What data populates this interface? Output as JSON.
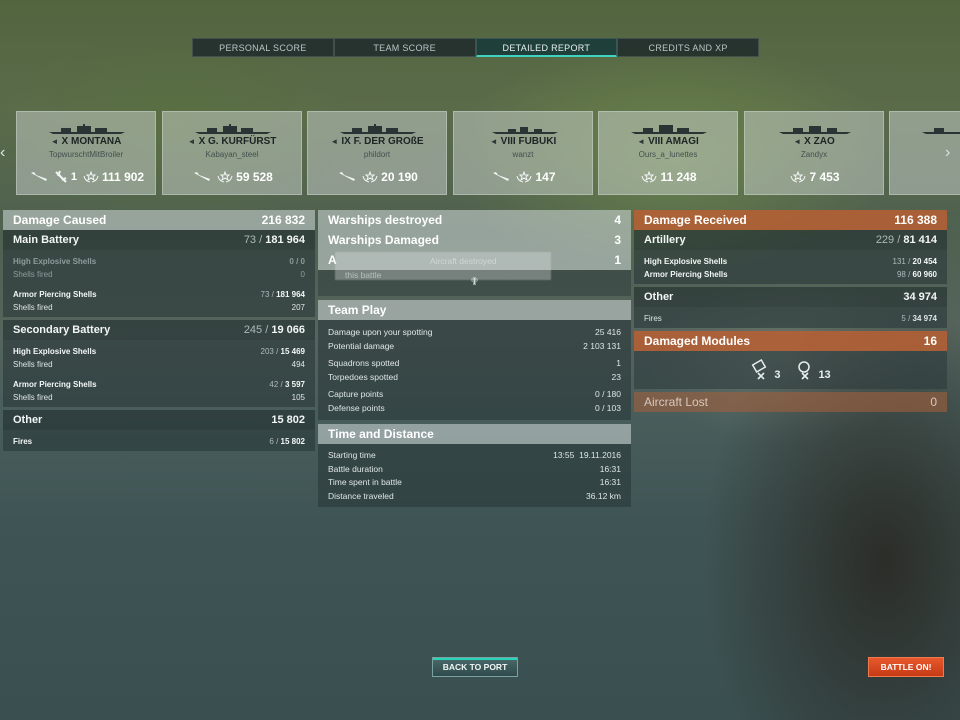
{
  "tabs": [
    {
      "label": "PERSONAL SCORE"
    },
    {
      "label": "TEAM SCORE"
    },
    {
      "label": "DETAILED REPORT"
    },
    {
      "label": "CREDITS AND XP"
    }
  ],
  "active_tab": "DETAILED REPORT",
  "ships": [
    {
      "tier_name": "X MONTANA",
      "player": "TopwurschtMitBroiler",
      "s1": "",
      "s2": "1",
      "s3": "111 902"
    },
    {
      "tier_name": "X G. KURFÜRST",
      "player": "Kabayan_steel",
      "s1": "",
      "s2": "",
      "s3": "59 528"
    },
    {
      "tier_name": "IX F. DER GROßE",
      "player": "phildort",
      "s1": "",
      "s2": "",
      "s3": "20 190"
    },
    {
      "tier_name": "VIII FUBUKI",
      "player": "wanzt",
      "s1": "",
      "s2": "",
      "s3": "147"
    },
    {
      "tier_name": "VIII AMAGI",
      "player": "Ours_a_lunettes",
      "s1": "",
      "s2": "",
      "s3": "11 248"
    },
    {
      "tier_name": "X ZAO",
      "player": "Zandyx",
      "s1": "",
      "s2": "",
      "s3": "7 453"
    }
  ],
  "damage_caused": {
    "title": "Damage Caused",
    "total": "216 832",
    "main_battery": {
      "label": "Main Battery",
      "hits": "73",
      "total": "181 964",
      "he_label": "High Explosive Shells",
      "he_hits": "0",
      "he_total": "0",
      "he_fired_label": "Shells fired",
      "he_fired": "0",
      "ap_label": "Armor Piercing Shells",
      "ap_hits": "73",
      "ap_total": "181 964",
      "ap_fired_label": "Shells fired",
      "ap_fired": "207"
    },
    "secondary_battery": {
      "label": "Secondary Battery",
      "hits": "245",
      "total": "19 066",
      "he_label": "High Explosive Shells",
      "he_hits": "203",
      "he_total": "15 469",
      "he_fired_label": "Shells fired",
      "he_fired": "494",
      "ap_label": "Armor Piercing Shells",
      "ap_hits": "42",
      "ap_total": "3 597",
      "ap_fired_label": "Shells fired",
      "ap_fired": "105"
    },
    "other": {
      "label": "Other",
      "total": "15 802",
      "fires_label": "Fires",
      "fires_hits": "6",
      "fires_total": "15 802"
    }
  },
  "kills": {
    "destroyed_label": "Warships destroyed",
    "destroyed": "4",
    "damaged_label": "Warships Damaged",
    "damaged": "3",
    "aircraft_label": "A",
    "aircraft": "1",
    "tooltip_line1": "Aircraft destroyed",
    "tooltip_line2": "this battle"
  },
  "team_play": {
    "title": "Team Play",
    "rows": [
      {
        "label": "Damage upon your spotting",
        "value": "25 416"
      },
      {
        "label": "Potential damage",
        "value": "2 103 131"
      },
      {
        "label": "Squadrons spotted",
        "value": "1"
      },
      {
        "label": "Torpedoes spotted",
        "value": "23"
      },
      {
        "label": "Capture points",
        "value": "0 / 180"
      },
      {
        "label": "Defense points",
        "value": "0 / 103"
      }
    ]
  },
  "time_distance": {
    "title": "Time and Distance",
    "rows": [
      {
        "label": "Starting time",
        "value": "13:55  19.11.2016"
      },
      {
        "label": "Battle duration",
        "value": "16:31"
      },
      {
        "label": "Time spent in battle",
        "value": "16:31"
      },
      {
        "label": "Distance traveled",
        "value": "36.12 km"
      }
    ]
  },
  "damage_received": {
    "title": "Damage Received",
    "total": "116 388",
    "artillery": {
      "label": "Artillery",
      "hits": "229",
      "total": "81 414",
      "he_label": "High Explosive Shells",
      "he_hits": "131",
      "he_total": "20 454",
      "ap_label": "Armor Piercing Shells",
      "ap_hits": "98",
      "ap_total": "60 960"
    },
    "other": {
      "label": "Other",
      "total": "34 974",
      "fires_label": "Fires",
      "fires_hits": "5",
      "fires_total": "34 974"
    }
  },
  "damaged_modules": {
    "title": "Damaged Modules",
    "total": "16",
    "m1": "3",
    "m2": "13"
  },
  "aircraft_lost": {
    "title": "Aircraft Lost",
    "value": "0"
  },
  "buttons": {
    "back": "BACK TO PORT",
    "battle": "BATTLE ON!"
  },
  "colors": {
    "accent": "#3fd3c0",
    "orange": "#c55a2c",
    "battle": "#d8461e"
  },
  "icons": [
    "chevron-left-icon",
    "chevron-right-icon",
    "ship-silhouette-icon",
    "aircraft-icon",
    "torpedo-bomber-icon",
    "damage-laurel-icon",
    "module-icon"
  ]
}
